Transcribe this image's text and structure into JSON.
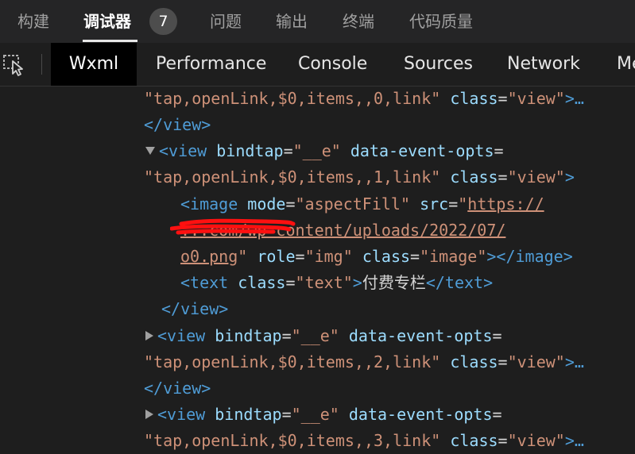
{
  "top_tabs": [
    {
      "label": "构建"
    },
    {
      "label": "调试器"
    },
    {
      "label": "问题"
    },
    {
      "label": "输出"
    },
    {
      "label": "终端"
    },
    {
      "label": "代码质量"
    }
  ],
  "debugger_badge": "7",
  "dev_tabs": [
    {
      "label": "Wxml"
    },
    {
      "label": "Performance"
    },
    {
      "label": "Console"
    },
    {
      "label": "Sources"
    },
    {
      "label": "Network"
    },
    {
      "label": "Me"
    }
  ],
  "code": {
    "l1": {
      "v1": "\"tap,openLink,$0,items,,0,link\"",
      "a1": "class",
      "v2": "\"view\"",
      "end": ">…"
    },
    "l2": {
      "close": "</view>"
    },
    "l3": {
      "open": "<view",
      "a1": "bindtap",
      "v1": "\"__e\"",
      "a2": "data-event-opts"
    },
    "l4": {
      "v1": "\"tap,openLink,$0,items,,1,link\"",
      "a1": "class",
      "v2": "\"view\"",
      "end": ">"
    },
    "l5": {
      "open": "<image",
      "a1": "mode",
      "v1": "\"aspectFill\"",
      "a2": "src",
      "q": "\"",
      "link": "https://"
    },
    "l6": {
      "link": "...com/wp-content/uploads/2022/07/"
    },
    "l7": {
      "link": "o0.png",
      "q": "\"",
      "a1": "role",
      "v1": "\"img\"",
      "a2": "class",
      "v2": "\"image\"",
      "end": "></image>"
    },
    "l8": {
      "open": "<text",
      "a1": "class",
      "v1": "\"text\"",
      "gt": ">",
      "content": "付费专栏",
      "close": "</text>"
    },
    "l9": {
      "close": "</view>"
    },
    "l10": {
      "open": "<view",
      "a1": "bindtap",
      "v1": "\"__e\"",
      "a2": "data-event-opts"
    },
    "l11": {
      "v1": "\"tap,openLink,$0,items,,2,link\"",
      "a1": "class",
      "v2": "\"view\"",
      "end": ">…"
    },
    "l12": {
      "close": "</view>"
    },
    "l13": {
      "open": "<view",
      "a1": "bindtap",
      "v1": "\"__e\"",
      "a2": "data-event-opts"
    },
    "l14": {
      "v1": "\"tap,openLink,$0,items,,3,link\"",
      "a1": "class",
      "v2": "\"view\"",
      "end": ">…"
    }
  },
  "colors": {
    "tag": "#4f9cd6",
    "attr": "#9cdcfe",
    "value": "#ce9178",
    "redaction": "#ff0000"
  }
}
